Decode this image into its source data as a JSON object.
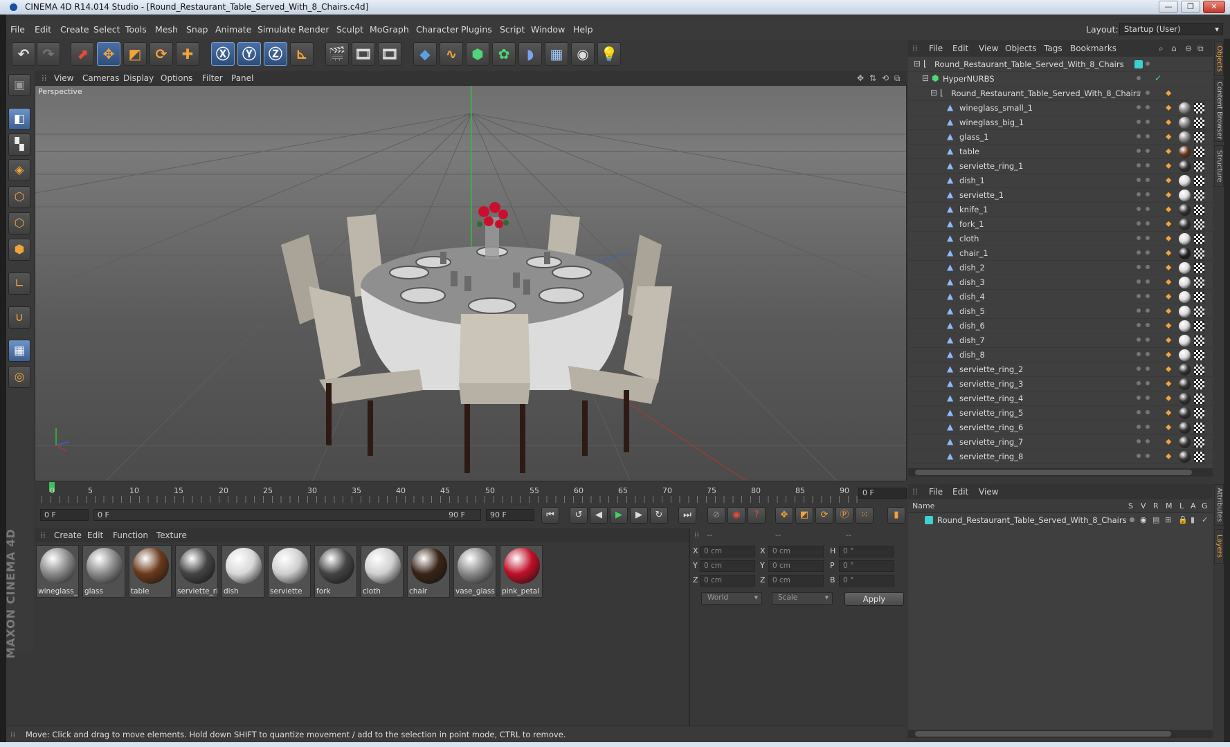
{
  "window": {
    "title": "CINEMA 4D R14.014 Studio - [Round_Restaurant_Table_Served_With_8_Chairs.c4d]",
    "minimize": "—",
    "maximize": "❐",
    "close": "✕"
  },
  "menubar": {
    "items": [
      "File",
      "Edit",
      "Create",
      "Select",
      "Tools",
      "Mesh",
      "Snap",
      "Animate",
      "Simulate",
      "Render",
      "Sculpt",
      "MoGraph",
      "Character",
      "Plugins",
      "Script",
      "Window",
      "Help"
    ],
    "layout_label": "Layout:",
    "layout_value": "Startup (User)"
  },
  "viewport": {
    "menu": [
      "View",
      "Cameras",
      "Display",
      "Options",
      "Filter",
      "Panel"
    ],
    "label": "Perspective"
  },
  "timeline": {
    "ticks": [
      "0",
      "5",
      "10",
      "15",
      "20",
      "25",
      "30",
      "35",
      "40",
      "45",
      "50",
      "55",
      "60",
      "65",
      "70",
      "75",
      "80",
      "85",
      "90"
    ],
    "current_frame": "0 F"
  },
  "playbar": {
    "start_field": "0 F",
    "range_start": "0 F",
    "range_end": "90 F",
    "end_field": "90 F"
  },
  "materials": {
    "menu": [
      "Create",
      "Edit",
      "Function",
      "Texture"
    ],
    "items": [
      {
        "label": "wineglass_",
        "color": "#8a8a8a"
      },
      {
        "label": "glass",
        "color": "#8a8a8a"
      },
      {
        "label": "table",
        "color": "#6b3a1c"
      },
      {
        "label": "serviette_ri",
        "color": "#444"
      },
      {
        "label": "dish",
        "color": "#d8d8d8"
      },
      {
        "label": "serviette",
        "color": "#cfcfcf"
      },
      {
        "label": "fork",
        "color": "#444"
      },
      {
        "label": "cloth",
        "color": "#d0d0d0"
      },
      {
        "label": "chair",
        "color": "#3a2418"
      },
      {
        "label": "vase_glass",
        "color": "#8a8a8a"
      },
      {
        "label": "pink_petal",
        "color": "#c0102a"
      }
    ]
  },
  "attributes": {
    "header": [
      "--",
      "--",
      "--"
    ],
    "rows": [
      {
        "a": "X",
        "av": "0 cm",
        "b": "X",
        "bv": "0 cm",
        "c": "H",
        "cv": "0 °"
      },
      {
        "a": "Y",
        "av": "0 cm",
        "b": "Y",
        "bv": "0 cm",
        "c": "P",
        "cv": "0 °"
      },
      {
        "a": "Z",
        "av": "0 cm",
        "b": "Z",
        "bv": "0 cm",
        "c": "B",
        "cv": "0 °"
      }
    ],
    "coord_mode": "World",
    "size_mode": "Scale",
    "apply": "Apply"
  },
  "status": "Move: Click and drag to move elements. Hold down SHIFT to quantize movement / add to the selection in point mode, CTRL to remove.",
  "objects": {
    "menu": [
      "File",
      "Edit",
      "View",
      "Objects",
      "Tags",
      "Bookmarks"
    ],
    "root": "Round_Restaurant_Table_Served_With_8_Chairs",
    "hypernurbs": "HyperNURBS",
    "group": "Round_Restaurant_Table_Served_With_8_Chairs",
    "children": [
      {
        "name": "wineglass_small_1",
        "mat": "#8a8a8a"
      },
      {
        "name": "wineglass_big_1",
        "mat": "#8a8a8a"
      },
      {
        "name": "glass_1",
        "mat": "#8a8a8a"
      },
      {
        "name": "table",
        "mat": "#6b3a1c"
      },
      {
        "name": "serviette_ring_1",
        "mat": "#333"
      },
      {
        "name": "dish_1",
        "mat": "#ddd"
      },
      {
        "name": "serviette_1",
        "mat": "#ddd"
      },
      {
        "name": "knife_1",
        "mat": "#333"
      },
      {
        "name": "fork_1",
        "mat": "#333"
      },
      {
        "name": "cloth",
        "mat": "#ddd"
      },
      {
        "name": "chair_1",
        "mat": "#222"
      },
      {
        "name": "dish_2",
        "mat": "#ddd"
      },
      {
        "name": "dish_3",
        "mat": "#ddd"
      },
      {
        "name": "dish_4",
        "mat": "#ddd"
      },
      {
        "name": "dish_5",
        "mat": "#ddd"
      },
      {
        "name": "dish_6",
        "mat": "#ddd"
      },
      {
        "name": "dish_7",
        "mat": "#ddd"
      },
      {
        "name": "dish_8",
        "mat": "#ddd"
      },
      {
        "name": "serviette_ring_2",
        "mat": "#333"
      },
      {
        "name": "serviette_ring_3",
        "mat": "#333"
      },
      {
        "name": "serviette_ring_4",
        "mat": "#333"
      },
      {
        "name": "serviette_ring_5",
        "mat": "#333"
      },
      {
        "name": "serviette_ring_6",
        "mat": "#333"
      },
      {
        "name": "serviette_ring_7",
        "mat": "#333"
      },
      {
        "name": "serviette_ring_8",
        "mat": "#333"
      }
    ]
  },
  "layers": {
    "menu": [
      "File",
      "Edit",
      "View"
    ],
    "columns": [
      "Name",
      "S",
      "V",
      "R",
      "M",
      "L",
      "A",
      "G"
    ],
    "row": "Round_Restaurant_Table_Served_With_8_Chairs"
  },
  "side_tabs": [
    "Objects",
    "Content Browser",
    "Structure",
    "Attributes",
    "Layers"
  ],
  "branding": "MAXON CINEMA 4D",
  "colors": {
    "accent": "#4a6fa5",
    "layer": "#3fd0d0",
    "tag_orange": "#f2a33a"
  }
}
